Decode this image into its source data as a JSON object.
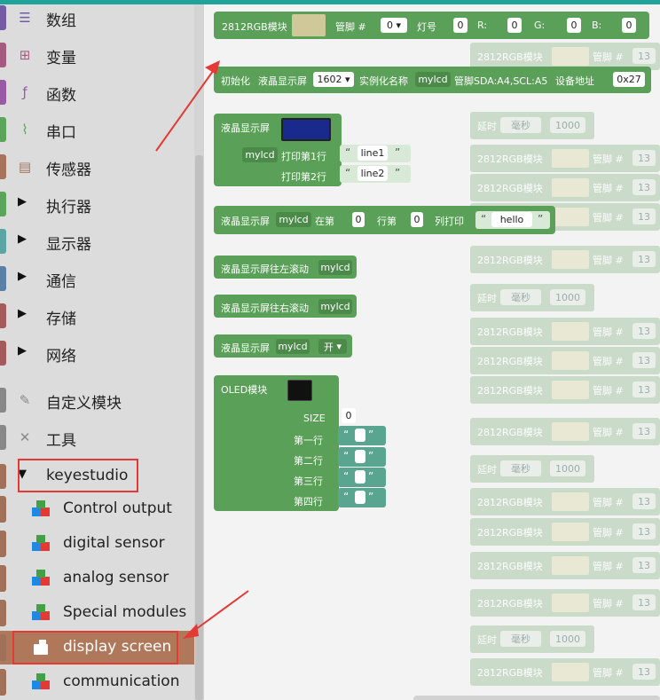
{
  "sidebar": {
    "categories": [
      {
        "label": "数组",
        "color": "#745ba5",
        "icon": "list-icon"
      },
      {
        "label": "变量",
        "color": "#a55b80",
        "icon": "variable-icon"
      },
      {
        "label": "函数",
        "color": "#995ba5",
        "icon": "function-icon"
      },
      {
        "label": "串口",
        "color": "#5ba55b",
        "icon": "serial-icon"
      },
      {
        "label": "传感器",
        "color": "#a5745b",
        "icon": "sensor-icon"
      },
      {
        "label": "执行器",
        "color": "#5ba55b"
      },
      {
        "label": "显示器",
        "color": "#5ba5a5"
      },
      {
        "label": "通信",
        "color": "#5b80a5"
      },
      {
        "label": "存储",
        "color": "#a55b5b"
      },
      {
        "label": "网络",
        "color": "#a55b5b"
      },
      {
        "label": "自定义模块",
        "color": "#888888",
        "icon": "pen-icon"
      },
      {
        "label": "工具",
        "color": "#888888",
        "icon": "tools-icon"
      },
      {
        "label": "keyestudio",
        "color": "#a07058"
      }
    ],
    "subitems": [
      {
        "label": "Control output"
      },
      {
        "label": "digital sensor"
      },
      {
        "label": "analog sensor"
      },
      {
        "label": "Special modules"
      },
      {
        "label": "display screen"
      },
      {
        "label": "communication"
      }
    ],
    "expand_arrow": "▶",
    "collapse_arrow": "▼"
  },
  "workspace": {
    "rgb_block": {
      "title": "2812RGB模块",
      "pin_label": "管脚 #",
      "pin_value": "0",
      "led_label": "灯号",
      "led_value": "0",
      "r_label": "R:",
      "r_value": "0",
      "g_label": "G:",
      "g_value": "0",
      "b_label": "B:",
      "b_value": "0"
    },
    "lcd_init": {
      "init_label": "初始化",
      "lcd_label": "液晶显示屏",
      "model": "1602",
      "inst_label": "实例化名称",
      "inst_value": "mylcd",
      "pins_label": "管脚SDA:A4,SCL:A5",
      "addr_label": "设备地址",
      "addr_value": "0x27"
    },
    "lcd_print": {
      "title": "液晶显示屏",
      "name": "mylcd",
      "row1_label": "打印第1行",
      "row1_value": "line1",
      "row2_label": "打印第2行",
      "row2_value": "line2"
    },
    "lcd_pos": {
      "title": "液晶显示屏",
      "name": "mylcd",
      "col_label": "在第",
      "col_value": "0",
      "row_label": "行第",
      "row_value": "0",
      "print_label": "列打印",
      "text": "hello"
    },
    "lcd_left": {
      "title": "液晶显示屏往左滚动",
      "name": "mylcd"
    },
    "lcd_right": {
      "title": "液晶显示屏往右滚动",
      "name": "mylcd"
    },
    "lcd_onoff": {
      "title": "液晶显示屏",
      "name": "mylcd",
      "state": "开"
    },
    "oled": {
      "title": "OLED模块",
      "size_label": "SIZE",
      "size_value": "0",
      "rows": [
        "第一行",
        "第二行",
        "第三行",
        "第四行"
      ]
    },
    "ghost": {
      "rgb": "2812RGB模块",
      "pin": "管脚 #",
      "pin_value": "13",
      "delay": "延时",
      "unit": "毫秒",
      "delay_value": "1000"
    }
  }
}
